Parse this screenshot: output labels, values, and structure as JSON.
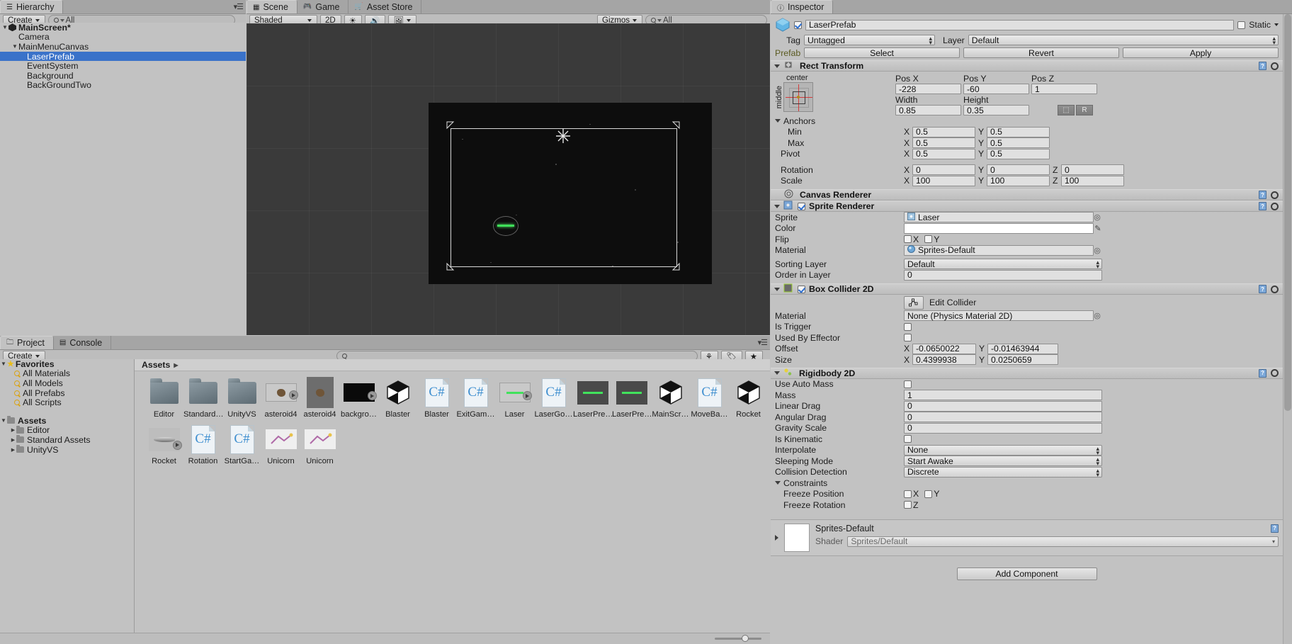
{
  "hierarchy": {
    "tab_label": "Hierarchy",
    "create_label": "Create",
    "search_placeholder": "All",
    "root": "MainScreen*",
    "items": [
      {
        "label": "Camera",
        "indent": 1,
        "expand": "",
        "selected": false
      },
      {
        "label": "MainMenuCanvas",
        "indent": 1,
        "expand": "down",
        "selected": false
      },
      {
        "label": "LaserPrefab",
        "indent": 2,
        "expand": "",
        "selected": true
      },
      {
        "label": "EventSystem",
        "indent": 2,
        "expand": "",
        "selected": false
      },
      {
        "label": "Background",
        "indent": 2,
        "expand": "",
        "selected": false
      },
      {
        "label": "BackGroundTwo",
        "indent": 2,
        "expand": "",
        "selected": false
      }
    ]
  },
  "scene": {
    "tabs": [
      {
        "label": "Scene",
        "icon": "scene-icon",
        "active": true
      },
      {
        "label": "Game",
        "icon": "game-icon",
        "active": false
      },
      {
        "label": "Asset Store",
        "icon": "store-icon",
        "active": false
      }
    ],
    "shading_mode": "Shaded",
    "mode_2d": "2D",
    "gizmos_label": "Gizmos",
    "gizmos_search_placeholder": "All"
  },
  "project": {
    "tabs": [
      {
        "label": "Project",
        "active": true
      },
      {
        "label": "Console",
        "active": false
      }
    ],
    "create_label": "Create",
    "search_placeholder": "",
    "favorites_label": "Favorites",
    "favorites": [
      "All Materials",
      "All Models",
      "All Prefabs",
      "All Scripts"
    ],
    "assets_label": "Assets",
    "assets_tree": [
      "Editor",
      "Standard Assets",
      "UnityVS"
    ],
    "breadcrumb": "Assets",
    "grid": [
      {
        "label": "Editor",
        "kind": "folder"
      },
      {
        "label": "Standard…",
        "kind": "folder"
      },
      {
        "label": "UnityVS",
        "kind": "folder"
      },
      {
        "label": "asteroid4",
        "kind": "sprite-light"
      },
      {
        "label": "asteroid4",
        "kind": "sprite-dark"
      },
      {
        "label": "backgro…",
        "kind": "black"
      },
      {
        "label": "Blaster",
        "kind": "unity"
      },
      {
        "label": "Blaster",
        "kind": "script"
      },
      {
        "label": "ExitGam…",
        "kind": "script"
      },
      {
        "label": "Laser",
        "kind": "laser"
      },
      {
        "label": "LaserGo…",
        "kind": "script"
      },
      {
        "label": "LaserPre…",
        "kind": "prefab-beam"
      },
      {
        "label": "LaserPre…",
        "kind": "prefab-beam"
      },
      {
        "label": "MainScr…",
        "kind": "unity"
      },
      {
        "label": "MoveBa…",
        "kind": "script"
      },
      {
        "label": "Rocket",
        "kind": "rocket"
      },
      {
        "label": "Rocket",
        "kind": "rocket2"
      },
      {
        "label": "Rotation",
        "kind": "script"
      },
      {
        "label": "StartGa…",
        "kind": "script"
      },
      {
        "label": "Unicorn",
        "kind": "unicorn"
      },
      {
        "label": "Unicorn",
        "kind": "unicorn"
      }
    ]
  },
  "inspector": {
    "tab_label": "Inspector",
    "object_name": "LaserPrefab",
    "object_enabled": true,
    "static_label": "Static",
    "tag_label": "Tag",
    "tag_value": "Untagged",
    "layer_label": "Layer",
    "layer_value": "Default",
    "prefab_label": "Prefab",
    "prefab_buttons": [
      "Select",
      "Revert",
      "Apply"
    ],
    "rect_transform": {
      "title": "Rect Transform",
      "anchor_preset_h": "center",
      "anchor_preset_v": "middle",
      "pos_x_label": "Pos X",
      "pos_y_label": "Pos Y",
      "pos_z_label": "Pos Z",
      "pos_x": "-228",
      "pos_y": "-60",
      "pos_z": "1",
      "width_label": "Width",
      "height_label": "Height",
      "width": "0.85",
      "height": "0.35",
      "blueprint_label": "R",
      "anchors_label": "Anchors",
      "min_label": "Min",
      "max_label": "Max",
      "pivot_label": "Pivot",
      "min_x": "0.5",
      "min_y": "0.5",
      "max_x": "0.5",
      "max_y": "0.5",
      "pivot_x": "0.5",
      "pivot_y": "0.5",
      "rotation_label": "Rotation",
      "rot_x": "0",
      "rot_y": "0",
      "rot_z": "0",
      "scale_label": "Scale",
      "scale_x": "100",
      "scale_y": "100",
      "scale_z": "100"
    },
    "canvas_renderer": {
      "title": "Canvas Renderer"
    },
    "sprite_renderer": {
      "title": "Sprite Renderer",
      "enabled": true,
      "sprite_label": "Sprite",
      "sprite_value": "Laser",
      "color_label": "Color",
      "color_value": "#ffffff",
      "flip_label": "Flip",
      "flip_x_label": "X",
      "flip_y_label": "Y",
      "flip_x": false,
      "flip_y": false,
      "material_label": "Material",
      "material_value": "Sprites-Default",
      "sorting_layer_label": "Sorting Layer",
      "sorting_layer_value": "Default",
      "order_in_layer_label": "Order in Layer",
      "order_in_layer_value": "0"
    },
    "box_collider_2d": {
      "title": "Box Collider 2D",
      "enabled": true,
      "edit_collider_label": "Edit Collider",
      "material_label": "Material",
      "material_value": "None (Physics Material 2D)",
      "is_trigger_label": "Is Trigger",
      "is_trigger": false,
      "used_by_effector_label": "Used By Effector",
      "used_by_effector": false,
      "offset_label": "Offset",
      "offset_x": "-0.0650022",
      "offset_y": "-0.01463944",
      "size_label": "Size",
      "size_x": "0.4399938",
      "size_y": "0.0250659"
    },
    "rigidbody_2d": {
      "title": "Rigidbody 2D",
      "use_auto_mass_label": "Use Auto Mass",
      "use_auto_mass": false,
      "mass_label": "Mass",
      "mass_value": "1",
      "linear_drag_label": "Linear Drag",
      "linear_drag_value": "0",
      "angular_drag_label": "Angular Drag",
      "angular_drag_value": "0",
      "gravity_scale_label": "Gravity Scale",
      "gravity_scale_value": "0",
      "is_kinematic_label": "Is Kinematic",
      "is_kinematic": false,
      "interpolate_label": "Interpolate",
      "interpolate_value": "None",
      "sleeping_mode_label": "Sleeping Mode",
      "sleeping_mode_value": "Start Awake",
      "collision_detection_label": "Collision Detection",
      "collision_detection_value": "Discrete",
      "constraints_label": "Constraints",
      "freeze_position_label": "Freeze Position",
      "freeze_position_x_label": "X",
      "freeze_position_y_label": "Y",
      "freeze_rotation_label": "Freeze Rotation",
      "freeze_rotation_z_label": "Z"
    },
    "material_preview": {
      "title": "Sprites-Default",
      "shader_label": "Shader",
      "shader_value": "Sprites/Default"
    },
    "add_component_label": "Add Component"
  }
}
